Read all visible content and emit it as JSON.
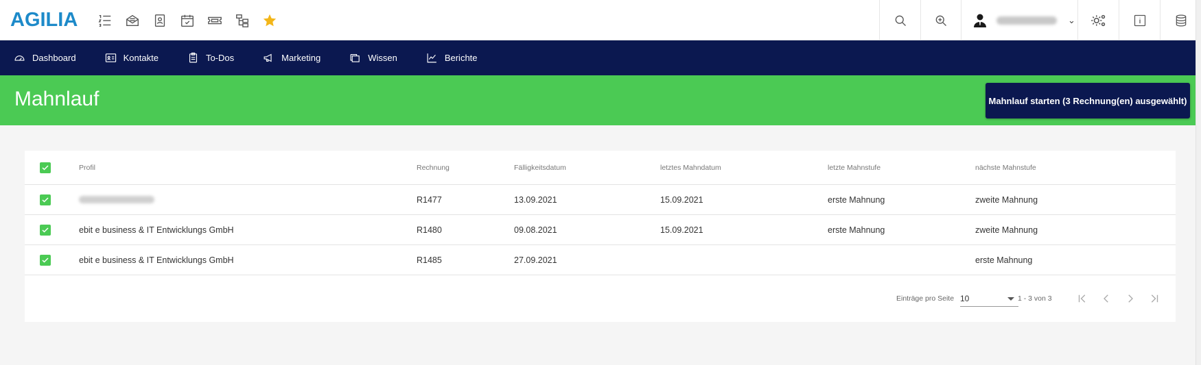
{
  "app": {
    "logo_text": "AGILIA",
    "brand_color": "#1d8ac9",
    "nav_color": "#0b1850",
    "accent_green": "#4bca54"
  },
  "quick_icons": [
    "list-numbered-icon",
    "inbox-icon",
    "contact-card-icon",
    "calendar-check-icon",
    "ticket-icon",
    "hierarchy-icon",
    "star-icon"
  ],
  "top_right": {
    "icons": [
      "search-icon",
      "zoom-in-icon",
      "user-avatar-icon",
      "settings-gears-icon",
      "info-icon",
      "database-icon"
    ]
  },
  "nav": {
    "items": [
      {
        "label": "Dashboard",
        "icon": "dashboard-icon"
      },
      {
        "label": "Kontakte",
        "icon": "contact-card-icon"
      },
      {
        "label": "To-Dos",
        "icon": "clipboard-icon"
      },
      {
        "label": "Marketing",
        "icon": "megaphone-icon"
      },
      {
        "label": "Wissen",
        "icon": "folders-icon"
      },
      {
        "label": "Berichte",
        "icon": "chart-line-icon"
      }
    ]
  },
  "page": {
    "title": "Mahnlauf",
    "start_button": "Mahnlauf starten (3 Rechnung(en) ausgewählt)"
  },
  "table": {
    "columns": {
      "profil": "Profil",
      "rechnung": "Rechnung",
      "faellig": "Fälligkeitsdatum",
      "letztes_mahndatum": "letztes Mahndatum",
      "letzte_mahnstufe": "letzte Mahnstufe",
      "naechste_mahnstufe": "nächste Mahnstufe"
    },
    "rows": [
      {
        "profil": "",
        "rechnung": "R1477",
        "faellig": "13.09.2021",
        "letztes_mahndatum": "15.09.2021",
        "letzte_mahnstufe": "erste Mahnung",
        "naechste_mahnstufe": "zweite Mahnung",
        "checked": true
      },
      {
        "profil": "ebit e business & IT Entwicklungs GmbH",
        "rechnung": "R1480",
        "faellig": "09.08.2021",
        "letztes_mahndatum": "15.09.2021",
        "letzte_mahnstufe": "erste Mahnung",
        "naechste_mahnstufe": "zweite Mahnung",
        "checked": true
      },
      {
        "profil": "ebit e business & IT Entwicklungs GmbH",
        "rechnung": "R1485",
        "faellig": "27.09.2021",
        "letztes_mahndatum": "",
        "letzte_mahnstufe": "",
        "naechste_mahnstufe": "erste Mahnung",
        "checked": true
      }
    ]
  },
  "paginator": {
    "label": "Einträge pro Seite",
    "page_size": "10",
    "range": "1 - 3 von 3"
  }
}
